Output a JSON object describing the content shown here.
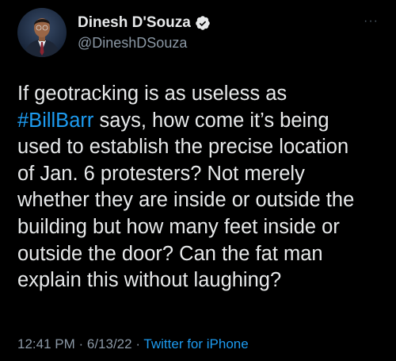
{
  "author": {
    "display_name": "Dinesh D'Souza",
    "handle": "@DineshDSouza",
    "verified": true,
    "avatar_icon": "profile-photo"
  },
  "menu": {
    "more_icon": "more-horizontal-icon",
    "more_label": "···"
  },
  "tweet": {
    "line1": "If geotracking is as useless as",
    "hashtag": "#BillBarr",
    "line2_rest": " says, how come it’s being",
    "line3": "used to establish the precise location",
    "line4": "of Jan. 6 protesters? Not merely",
    "line5": "whether they are inside or outside the",
    "line6": "building but how many feet inside or",
    "line7": "outside the door? Can the fat man",
    "line8": "explain this without laughing?"
  },
  "meta": {
    "time": "12:41 PM",
    "sep1": " · ",
    "date": "6/13/22",
    "sep2": " · ",
    "source": "Twitter for iPhone"
  },
  "colors": {
    "background": "#000000",
    "text": "#e7e9ea",
    "secondary": "#8b98a5",
    "accent": "#1d9bf0"
  }
}
